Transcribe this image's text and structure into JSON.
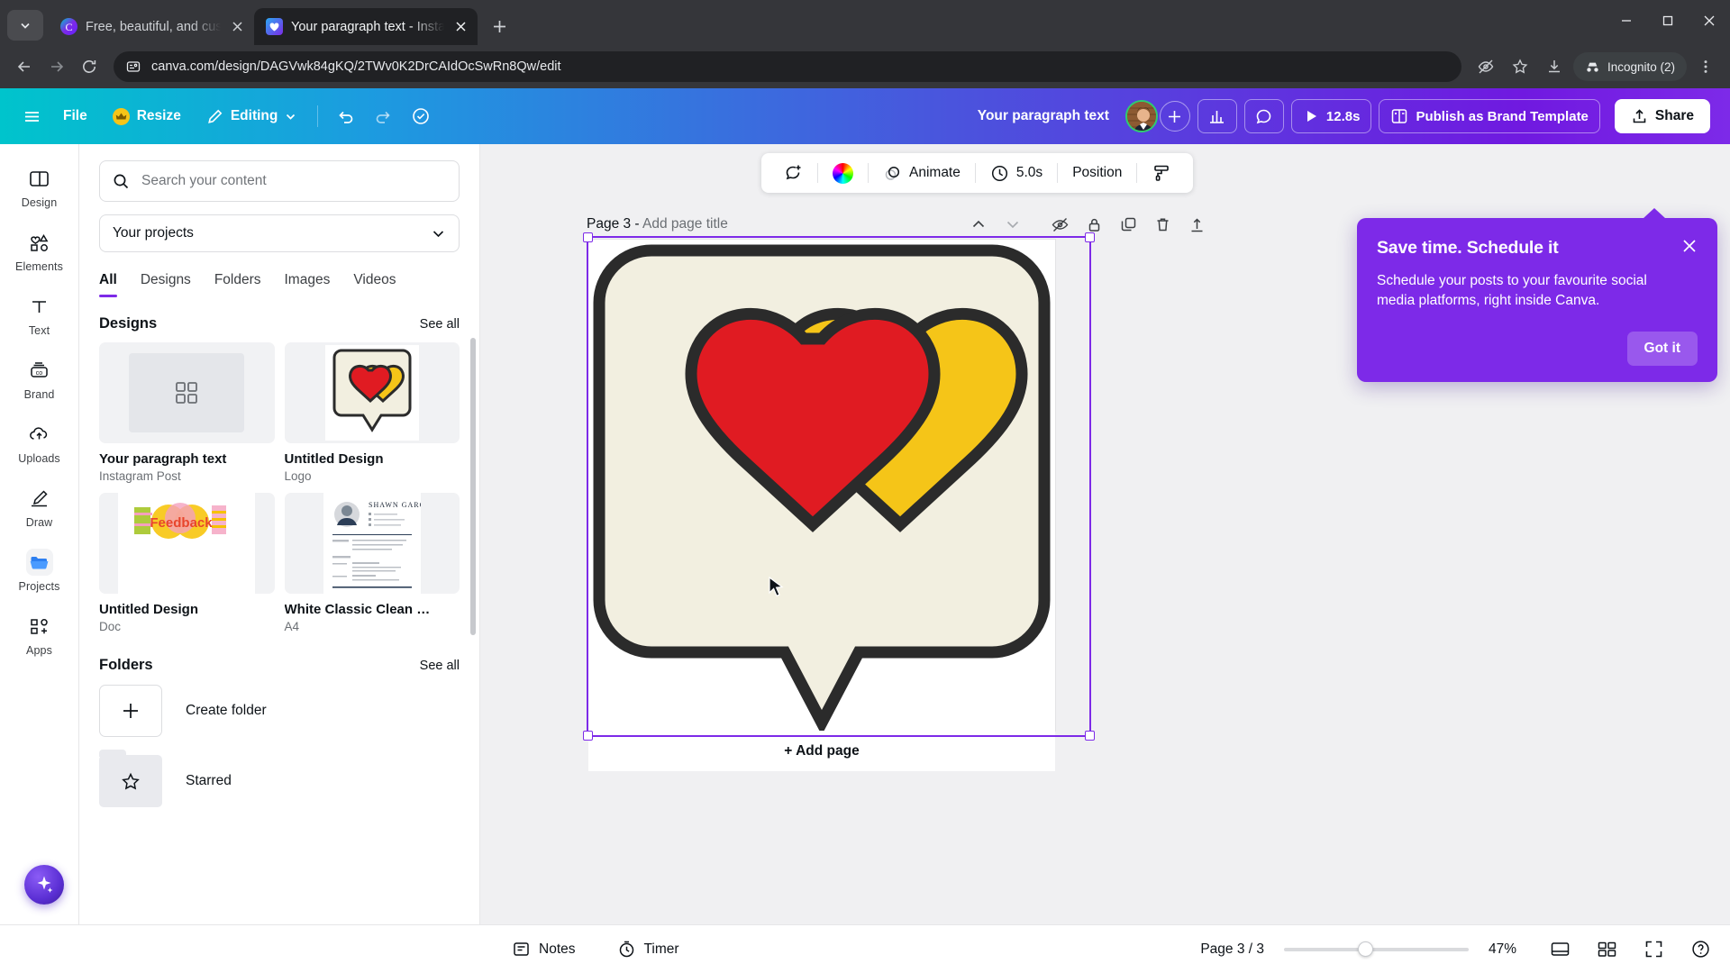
{
  "browser": {
    "tabs": [
      {
        "title": "Free, beautiful, and customizab",
        "favicon": "canva-icon",
        "active": false
      },
      {
        "title": "Your paragraph text - Instagram",
        "favicon": "heart-icon",
        "active": true
      }
    ],
    "new_tab_label": "+",
    "url": "canva.com/design/DAGVwk84gKQ/2TWv0K2DrCAIdOcSwRn8Qw/edit",
    "profile_label": "Incognito (2)",
    "icons": {
      "back": "back-arrow-icon",
      "forward": "forward-arrow-icon",
      "reload": "reload-icon",
      "site_info": "site-settings-icon",
      "third_party": "third-party-cookies-icon",
      "bookmark": "star-icon",
      "download": "download-icon",
      "menu": "kebab-menu-icon"
    }
  },
  "canva_header": {
    "menu_icon": "hamburger-menu-icon",
    "file_label": "File",
    "resize_label": "Resize",
    "resize_badge": "crown-icon",
    "editing_label": "Editing",
    "undo_icon": "undo-icon",
    "redo_icon": "redo-icon",
    "cloud_icon": "cloud-saved-icon",
    "doc_title": "Your paragraph text",
    "add_collaborator": "+",
    "insights_icon": "insights-chart-icon",
    "comment_icon": "comment-bubble-icon",
    "present_icon": "play-icon",
    "present_duration": "12.8s",
    "publish_label": "Publish as Brand Template",
    "publish_icon": "brand-template-icon",
    "share_label": "Share",
    "share_icon": "share-upload-icon"
  },
  "rail": {
    "items": [
      {
        "label": "Design",
        "icon": "design-layout-icon",
        "active": false
      },
      {
        "label": "Elements",
        "icon": "elements-shapes-icon",
        "active": false
      },
      {
        "label": "Text",
        "icon": "text-t-icon",
        "active": false
      },
      {
        "label": "Brand",
        "icon": "brand-kit-icon",
        "active": false
      },
      {
        "label": "Uploads",
        "icon": "upload-cloud-icon",
        "active": false
      },
      {
        "label": "Draw",
        "icon": "draw-pen-icon",
        "active": false
      },
      {
        "label": "Projects",
        "icon": "projects-folder-icon",
        "active": true
      },
      {
        "label": "Apps",
        "icon": "apps-grid-icon",
        "active": false
      }
    ],
    "ai_assistant_icon": "magic-sparkle-icon"
  },
  "panel": {
    "search_placeholder": "Search your content",
    "search_icon": "search-icon",
    "filter_value": "Your projects",
    "filter_chevron": "chevron-down-icon",
    "tabs": [
      {
        "label": "All",
        "active": true
      },
      {
        "label": "Designs",
        "active": false
      },
      {
        "label": "Folders",
        "active": false
      },
      {
        "label": "Images",
        "active": false
      },
      {
        "label": "Videos",
        "active": false
      }
    ],
    "designs_section": {
      "title": "Designs",
      "see_all": "See all",
      "items": [
        {
          "name": "Your paragraph text",
          "type": "Instagram Post",
          "thumb": "placeholder-grid"
        },
        {
          "name": "Untitled Design",
          "type": "Logo",
          "thumb": "heart-speech-bubble"
        },
        {
          "name": "Untitled Design",
          "type": "Doc",
          "thumb": "feedback-banner"
        },
        {
          "name": "White Classic Clean …",
          "type": "A4",
          "thumb": "resume-document"
        }
      ]
    },
    "folders_section": {
      "title": "Folders",
      "see_all": "See all",
      "create_label": "Create folder",
      "create_icon": "plus-icon",
      "items": [
        {
          "name": "Starred",
          "icon": "star-folder-icon"
        }
      ]
    }
  },
  "float_toolbar": {
    "comment_icon": "add-comment-icon",
    "color_icon": "color-wheel-icon",
    "animate_label": "Animate",
    "animate_icon": "animate-icon",
    "timer_label": "5.0s",
    "timer_icon": "clock-icon",
    "position_label": "Position",
    "style_icon": "paint-roller-icon"
  },
  "editor": {
    "page_label": "Page 3 - ",
    "page_title_placeholder": "Add page title",
    "add_page_label": "+ Add page",
    "page_actions": [
      {
        "icon": "move-up-icon"
      },
      {
        "icon": "move-down-icon"
      },
      {
        "icon": "hide-page-icon"
      },
      {
        "icon": "lock-page-icon"
      },
      {
        "icon": "duplicate-page-icon"
      },
      {
        "icon": "delete-page-icon"
      },
      {
        "icon": "expand-page-icon"
      }
    ],
    "canvas": {
      "background": "#F2EFE0",
      "heart_red": "#E01B22",
      "heart_yellow": "#F5C518",
      "outline": "#2B2B2B"
    }
  },
  "notification": {
    "title": "Save time. Schedule it",
    "body": "Schedule your posts to your favourite social media platforms, right inside Canva.",
    "cta_label": "Got it",
    "close_icon": "close-icon",
    "accent": "#7D2AE8"
  },
  "statusbar": {
    "notes_label": "Notes",
    "notes_icon": "notes-icon",
    "timer_label": "Timer",
    "timer_icon": "timer-clock-icon",
    "page_indicator": "Page 3 / 3",
    "zoom_value": "47%",
    "grid_view_icon": "grid-view-icon",
    "pages_view_icon": "pages-view-icon",
    "fullscreen_icon": "fullscreen-icon",
    "help_icon": "help-question-icon"
  }
}
